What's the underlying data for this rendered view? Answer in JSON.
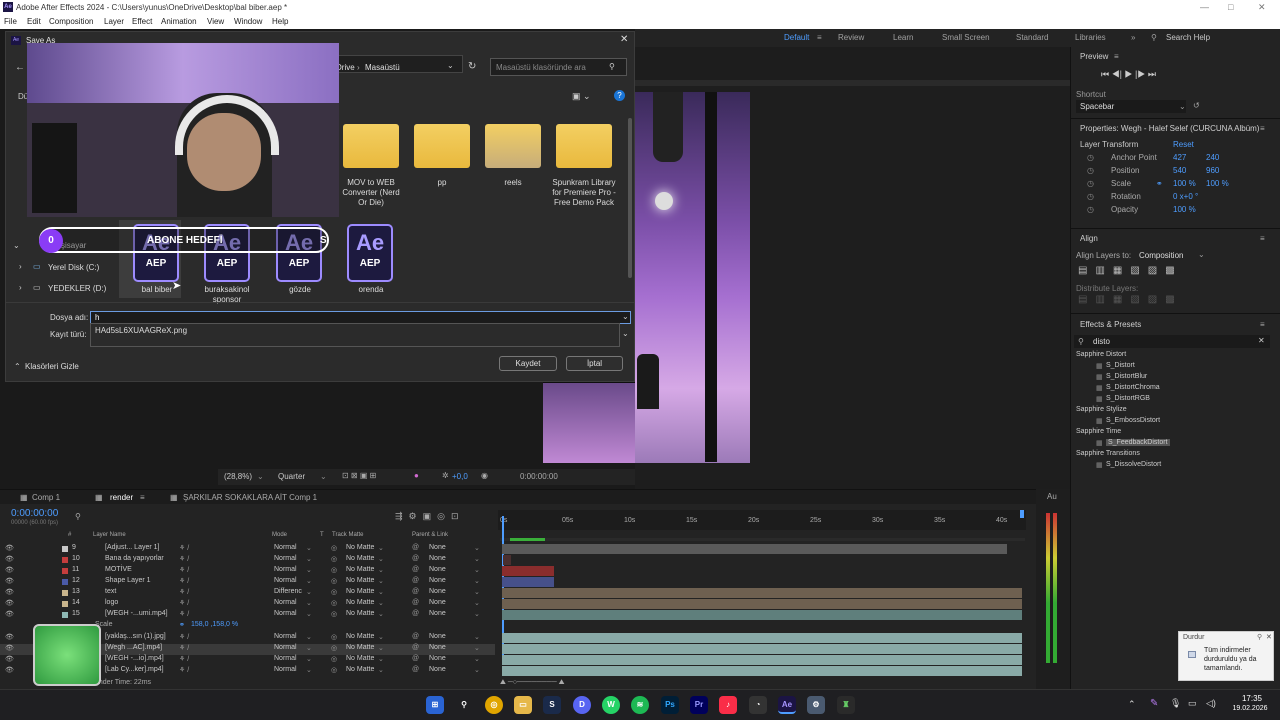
{
  "window": {
    "title": "Adobe After Effects 2024 - C:\\Users\\yunus\\OneDrive\\Desktop\\bal biber.aep *",
    "app_icon": "Ae"
  },
  "menu": [
    "File",
    "Edit",
    "Composition",
    "Layer",
    "Effect",
    "Animation",
    "View",
    "Window",
    "Help"
  ],
  "workspaces": {
    "items": [
      "Default",
      "Review",
      "Learn",
      "Small Screen",
      "Standard",
      "Libraries"
    ],
    "active": "Default",
    "search": "Search Help"
  },
  "dialog": {
    "title": "Save As",
    "breadcrumb": [
      "Drive",
      "Masaüstü"
    ],
    "search_placeholder": "Masaüstü klasöründe ara",
    "partial_left": "Dü",
    "folders": [
      {
        "name": "MOV to WEB Converter (Nerd Or Die)"
      },
      {
        "name": "pp"
      },
      {
        "name": "reels"
      },
      {
        "name": "Spunkram Library for Premiere Pro - Free Demo Pack"
      }
    ],
    "aep_files": [
      {
        "name": "bal biber"
      },
      {
        "name": "buraksakinol sponsor"
      },
      {
        "name": "gözde"
      },
      {
        "name": "orenda"
      }
    ],
    "aep_icon": {
      "ae": "Ae",
      "ext": "AEP"
    },
    "tree": [
      {
        "label": "şisayar"
      },
      {
        "label": "Yerel Disk (C:)"
      },
      {
        "label": "YEDEKLER (D:)"
      }
    ],
    "filename_label": "Dosya adı:",
    "filename_value": "h",
    "suggestion": "HAd5sL6XUAAGReX.png",
    "type_label": "Kayıt türü:",
    "hide_folders": "Klasörleri Gizle",
    "save": "Kaydet",
    "cancel": "İptal"
  },
  "overlay": {
    "abone_label": "ABONE HEDEFİ",
    "abone_count": "0",
    "abone_suffix": "S"
  },
  "viewer": {
    "zoom": "(28,8%)",
    "quality": "Quarter",
    "exposure": "+0,0",
    "timecode": "0:00:00:00"
  },
  "preview": {
    "title": "Preview",
    "shortcut_label": "Shortcut",
    "shortcut_value": "Spacebar"
  },
  "properties": {
    "title": "Properties: Wegh - Halef Selef (CURCUNA Albüm) (0",
    "section": "Layer Transform",
    "reset": "Reset",
    "rows": [
      {
        "name": "Anchor Point",
        "v1": "427",
        "v2": "240"
      },
      {
        "name": "Position",
        "v1": "540",
        "v2": "960"
      },
      {
        "name": "Scale",
        "v1": "100 %",
        "v2": "100 %"
      },
      {
        "name": "Rotation",
        "v1": "0 x+0 °",
        "v2": ""
      },
      {
        "name": "Opacity",
        "v1": "100 %",
        "v2": ""
      }
    ]
  },
  "align": {
    "title": "Align",
    "align_to_label": "Align Layers to:",
    "align_to": "Composition",
    "distribute": "Distribute Layers:"
  },
  "effects": {
    "title": "Effects & Presets",
    "search": "disto",
    "groups": [
      {
        "name": "Sapphire Distort",
        "items": [
          "S_Distort",
          "S_DistortBlur",
          "S_DistortChroma",
          "S_DistortRGB"
        ]
      },
      {
        "name": "Sapphire Stylize",
        "items": [
          "S_EmbossDistort"
        ]
      },
      {
        "name": "Sapphire Time",
        "items": [
          "S_FeedbackDistort"
        ]
      },
      {
        "name": "Sapphire Transitions",
        "items": [
          "S_DissolveDistort"
        ]
      }
    ]
  },
  "timeline": {
    "tabs": [
      "Comp 1",
      "render",
      "ŞARKILAR SOKAKLARA AİT Comp 1"
    ],
    "active_tab": "render",
    "timecode": "0:00:00:00",
    "fps": "00000 (60.00 fps)",
    "headers": {
      "num": "#",
      "layer": "Layer Name",
      "mode": "Mode",
      "t": "T",
      "track": "Track Matte",
      "parent": "Parent & Link"
    },
    "ruler": [
      "0s",
      "05s",
      "10s",
      "15s",
      "20s",
      "25s",
      "30s",
      "35s",
      "40s"
    ],
    "layers": [
      {
        "n": "9",
        "name": "[Adjust... Layer 1]",
        "mode": "Normal",
        "matte": "No Matte",
        "parent": "None",
        "color": "#c8c8c8"
      },
      {
        "n": "10",
        "name": "Bana da yapıyorlar",
        "mode": "Normal",
        "matte": "No Matte",
        "parent": "None",
        "color": "#c43d3d"
      },
      {
        "n": "11",
        "name": "MOTİVE",
        "mode": "Normal",
        "matte": "No Matte",
        "parent": "None",
        "color": "#c43d3d"
      },
      {
        "n": "12",
        "name": "Shape Layer 1",
        "mode": "Normal",
        "matte": "No Matte",
        "parent": "None",
        "color": "#4a5aa8"
      },
      {
        "n": "13",
        "name": "text",
        "mode": "Differenc",
        "matte": "No Matte",
        "parent": "None",
        "color": "#c8b48c"
      },
      {
        "n": "14",
        "name": "logo",
        "mode": "Normal",
        "matte": "No Matte",
        "parent": "None",
        "color": "#c8b48c"
      },
      {
        "n": "15",
        "name": "[WEGH -...umi.mp4]",
        "mode": "Normal",
        "matte": "No Matte",
        "parent": "None",
        "color": "#8fb9b5"
      },
      {
        "n": "",
        "name": "Scale",
        "mode": "",
        "matte": "",
        "parent": "",
        "color": ""
      },
      {
        "n": "",
        "name": "[yaklaş...sın (1).jpg]",
        "mode": "Normal",
        "matte": "No Matte",
        "parent": "None",
        "color": "#8fb9b5"
      },
      {
        "n": "",
        "name": "[Wegh ...AC].mp4]",
        "mode": "Normal",
        "matte": "No Matte",
        "parent": "None",
        "color": "#8fb9b5"
      },
      {
        "n": "",
        "name": "[WEGH -...io].mp4]",
        "mode": "Normal",
        "matte": "No Matte",
        "parent": "None",
        "color": "#8fb9b5"
      },
      {
        "n": "",
        "name": "[Lab Cy...ker].mp4]",
        "mode": "Normal",
        "matte": "No Matte",
        "parent": "None",
        "color": "#8fb9b5"
      }
    ],
    "scale_value": "158,0 ,158,0 %",
    "render_time": "ender Time: 22ms"
  },
  "notification": {
    "title": "Durdur",
    "text": "Tüm indirmeler durduruldu ya da tamamlandı."
  },
  "taskbar": {
    "time": "17:35",
    "date": "19.02.2026"
  },
  "colors": {
    "accent": "#4e9dff",
    "ae_purple": "#9d8bff",
    "folder": "#f0c54e"
  }
}
